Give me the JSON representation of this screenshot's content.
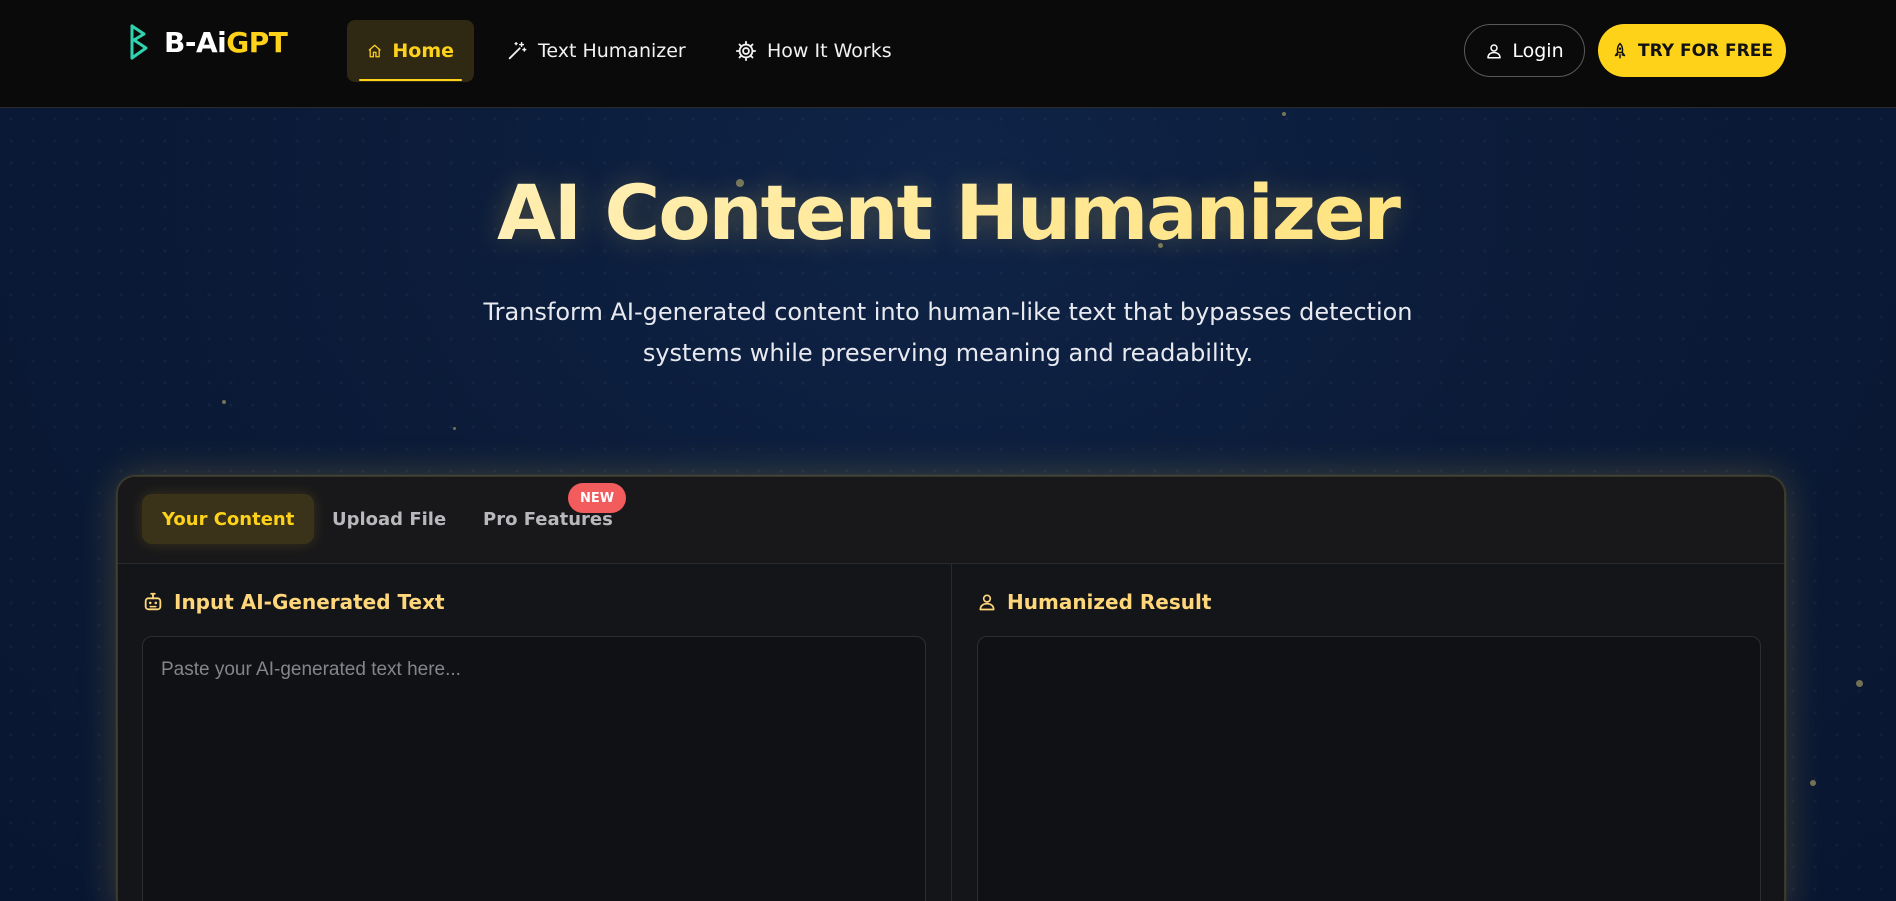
{
  "brand": {
    "logo_white": "B-Ai",
    "logo_yellow": "GPT",
    "logo_icon": "b-logo-icon",
    "accent": "#ffd21a"
  },
  "nav": {
    "items": [
      {
        "label": "Home",
        "icon": "home-icon",
        "active": true
      },
      {
        "label": "Text Humanizer",
        "icon": "magic-wand-icon",
        "active": false
      },
      {
        "label": "How It Works",
        "icon": "gear-icon",
        "active": false
      }
    ],
    "login_label": "Login",
    "login_icon": "user-icon",
    "try_label": "TRY FOR FREE",
    "try_icon": "rocket-icon"
  },
  "hero": {
    "title": "AI Content Humanizer",
    "subtitle_line1": "Transform AI-generated content into human-like text that bypasses detection",
    "subtitle_line2": "systems while preserving meaning and readability."
  },
  "panel": {
    "tabs": [
      {
        "label": "Your Content",
        "active": true
      },
      {
        "label": "Upload File",
        "active": false
      },
      {
        "label": "Pro Features",
        "active": false
      }
    ],
    "new_badge": "NEW",
    "input": {
      "heading": "Input AI-Generated Text",
      "icon": "robot-icon",
      "placeholder": "Paste your AI-generated text here...",
      "value": ""
    },
    "output": {
      "heading": "Humanized Result",
      "icon": "user-icon",
      "value": ""
    }
  }
}
